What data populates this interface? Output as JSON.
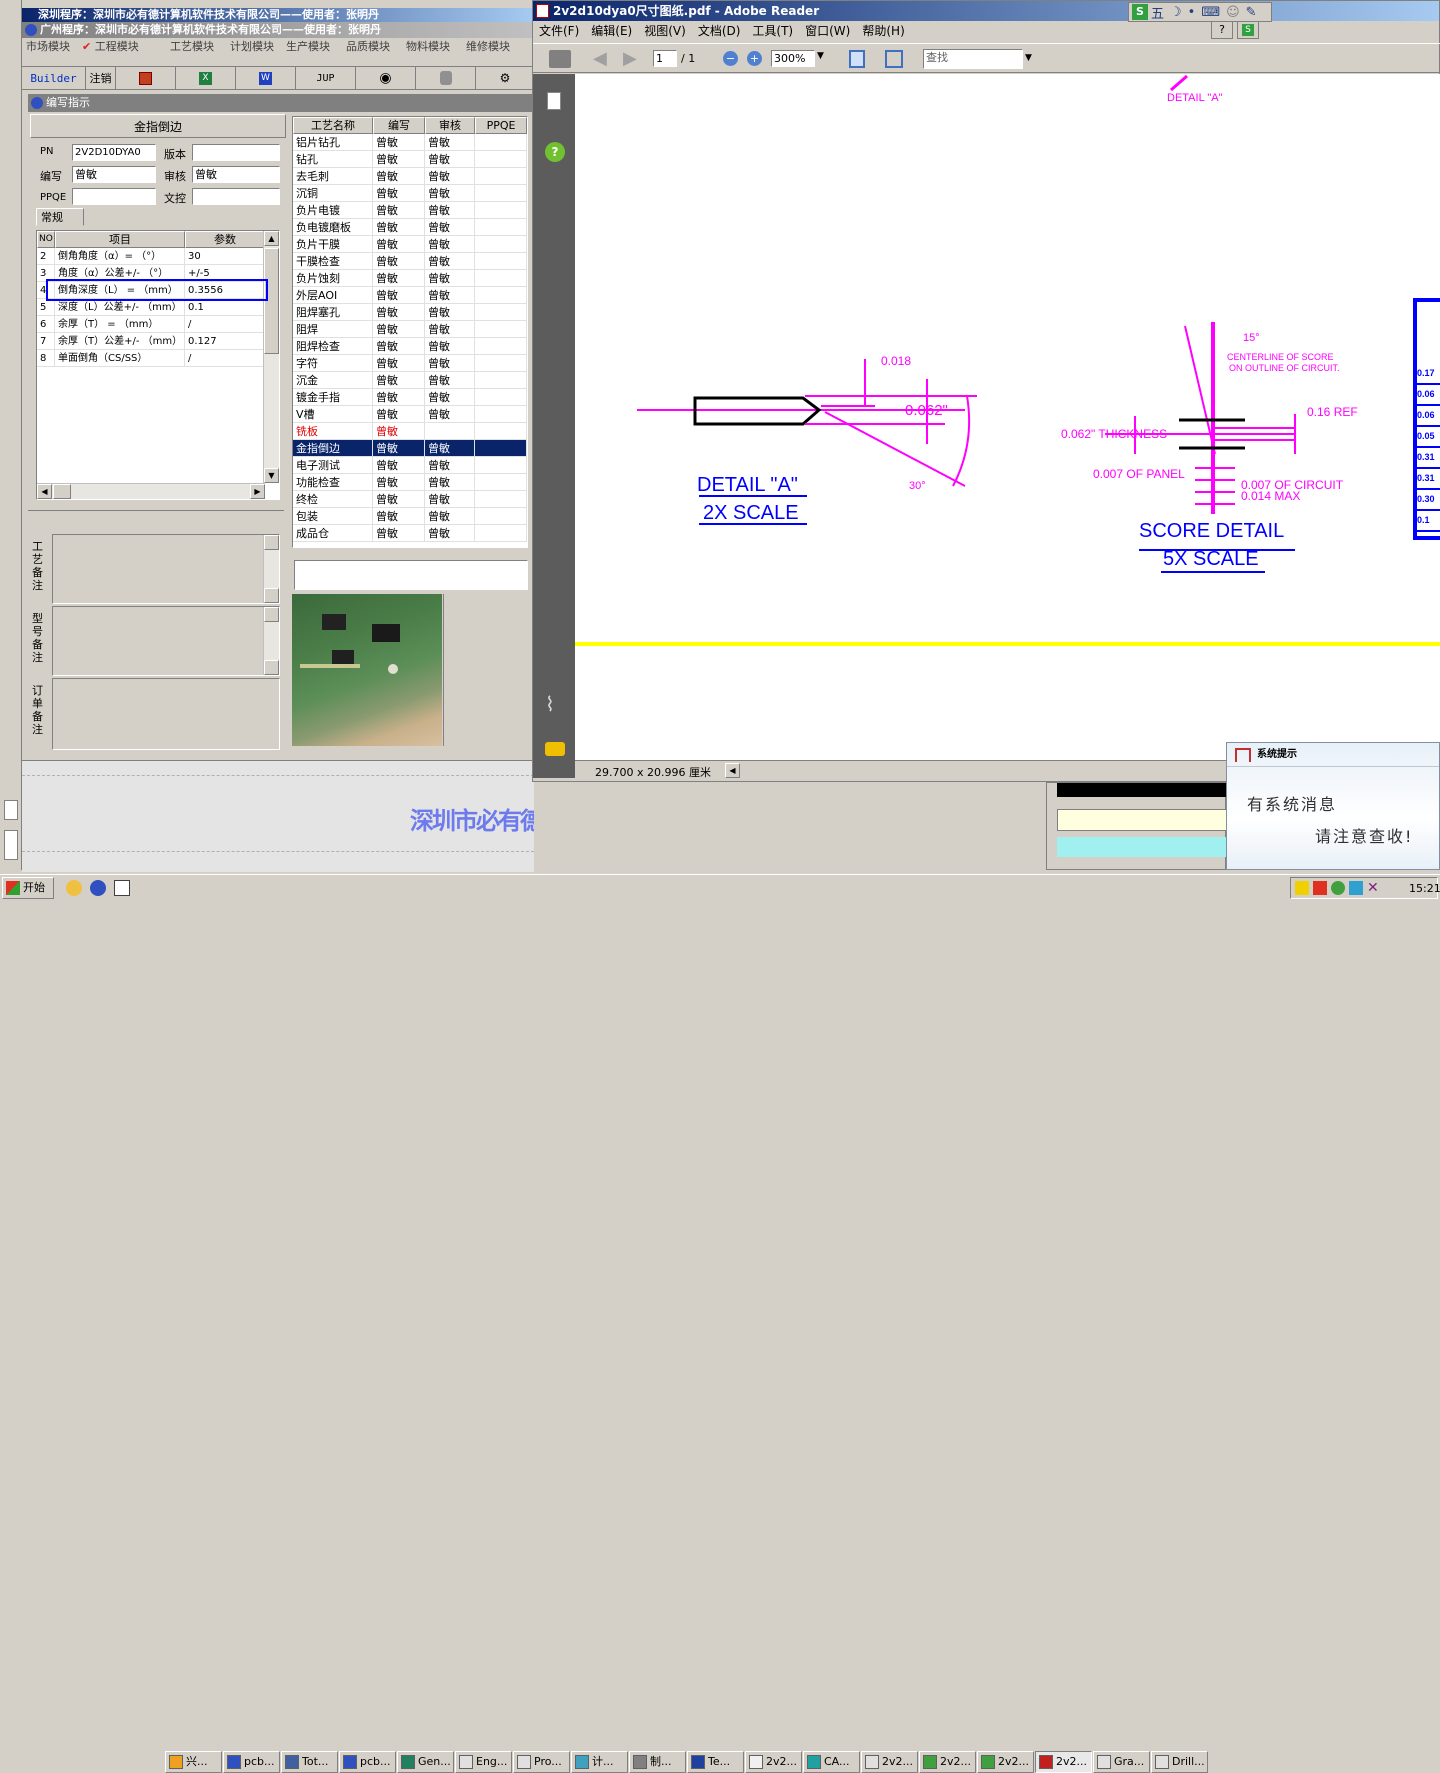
{
  "back_window": {
    "title": "深圳程序：深圳市必有德计算机软件技术有限公司——使用者：张明丹"
  },
  "main_window": {
    "title": "广州程序：深圳市必有德计算机软件技术有限公司——使用者：张明丹",
    "menu": [
      "市场模块",
      "工程模块",
      "工艺模块",
      "计划模块",
      "生产模块",
      "品质模块",
      "物料模块",
      "维修模块"
    ],
    "toolbar": {
      "builder": "Builder",
      "logout": "注销",
      "jup": "JUP"
    },
    "panel_title": "编写指示",
    "form": {
      "heading": "金指倒边",
      "pn_label": "PN",
      "pn_value": "2V2D10DYA0",
      "version_label": "版本",
      "version_value": "",
      "author_label": "编写",
      "author_value": "曾敏",
      "review_label": "审核",
      "review_value": "曾敏",
      "ppqe_label": "PPQE",
      "ppqe_value": "",
      "doc_label": "文控",
      "doc_value": "",
      "tab": "常规"
    },
    "param_table": {
      "headers": [
        "NO",
        "项目",
        "参数"
      ],
      "rows": [
        {
          "no": "2",
          "item": "倒角角度（α）=  （°）",
          "value": "30"
        },
        {
          "no": "3",
          "item": "角度（α）公差+/-  （°）",
          "value": "+/-5"
        },
        {
          "no": "4",
          "item": "倒角深度（L） =  （mm）",
          "value": "0.3556"
        },
        {
          "no": "5",
          "item": "深度（L）公差+/-  （mm）",
          "value": "0.1"
        },
        {
          "no": "6",
          "item": "余厚（T） =  （mm）",
          "value": "/"
        },
        {
          "no": "7",
          "item": "余厚（T）公差+/-  （mm）",
          "value": "0.127"
        },
        {
          "no": "8",
          "item": "单面倒角（CS/SS）",
          "value": "/"
        }
      ]
    },
    "remarks": [
      "工艺备注",
      "型号备注",
      "订单备注"
    ],
    "process_table": {
      "headers": [
        "工艺名称",
        "编写",
        "审核",
        "PPQE"
      ],
      "rows": [
        {
          "name": "铝片钻孔",
          "author": "曾敏",
          "review": "曾敏"
        },
        {
          "name": "钻孔",
          "author": "曾敏",
          "review": "曾敏"
        },
        {
          "name": "去毛刺",
          "author": "曾敏",
          "review": "曾敏"
        },
        {
          "name": "沉铜",
          "author": "曾敏",
          "review": "曾敏"
        },
        {
          "name": "负片电镀",
          "author": "曾敏",
          "review": "曾敏"
        },
        {
          "name": "负电镀磨板",
          "author": "曾敏",
          "review": "曾敏"
        },
        {
          "name": "负片干膜",
          "author": "曾敏",
          "review": "曾敏"
        },
        {
          "name": "干膜检查",
          "author": "曾敏",
          "review": "曾敏"
        },
        {
          "name": "负片蚀刻",
          "author": "曾敏",
          "review": "曾敏"
        },
        {
          "name": "外层AOI",
          "author": "曾敏",
          "review": "曾敏"
        },
        {
          "name": "阻焊塞孔",
          "author": "曾敏",
          "review": "曾敏"
        },
        {
          "name": "阻焊",
          "author": "曾敏",
          "review": "曾敏"
        },
        {
          "name": "阻焊检查",
          "author": "曾敏",
          "review": "曾敏"
        },
        {
          "name": "字符",
          "author": "曾敏",
          "review": "曾敏"
        },
        {
          "name": "沉金",
          "author": "曾敏",
          "review": "曾敏"
        },
        {
          "name": "镀金手指",
          "author": "曾敏",
          "review": "曾敏"
        },
        {
          "name": "V槽",
          "author": "曾敏",
          "review": "曾敏"
        },
        {
          "name": "铣板",
          "author": "曾敏",
          "review": ""
        },
        {
          "name": "金指倒边",
          "author": "曾敏",
          "review": "曾敏"
        },
        {
          "name": "电子测试",
          "author": "曾敏",
          "review": "曾敏"
        },
        {
          "name": "功能检查",
          "author": "曾敏",
          "review": "曾敏"
        },
        {
          "name": "终检",
          "author": "曾敏",
          "review": "曾敏"
        },
        {
          "name": "包装",
          "author": "曾敏",
          "review": "曾敏"
        },
        {
          "name": "成品仓",
          "author": "曾敏",
          "review": "曾敏"
        }
      ]
    },
    "banner": "深圳市必有德计算机软件技术有限公司"
  },
  "reader": {
    "title": "2v2d10dya0尺寸图纸.pdf - Adobe Reader",
    "menu": [
      "文件(F)",
      "编辑(E)",
      "视图(V)",
      "文档(D)",
      "工具(T)",
      "窗口(W)",
      "帮助(H)"
    ],
    "page_current": "1",
    "page_total": "/ 1",
    "zoom": "300%",
    "find_placeholder": "查找",
    "page_size": "29.700 x 20.996 厘米",
    "drawing": {
      "detail_top": "DETAIL \"A\"",
      "dim_018": "0.018",
      "dim_062": "0.062\"",
      "angle_30": "30°",
      "detail_a": "DETAIL \"A\"",
      "scale_2x": "2X SCALE",
      "angle_15": "15°",
      "centerline": "CENTERLINE OF SCORE",
      "outline": "ON OUTLINE OF CIRCUIT.",
      "ref": "0.16  REF",
      "thickness": "0.062\" THICKNESS",
      "panel": "0.007 OF PANEL",
      "circuit": "0.007 OF CIRCUIT",
      "max": "0.014 MAX",
      "score_detail": "SCORE DETAIL",
      "scale_5x": "5X SCALE",
      "right_cells": [
        "0.17",
        "0.06",
        "0.06",
        "0.05",
        "0.31",
        "0.31",
        "0.30",
        "0.1"
      ]
    }
  },
  "ime": {
    "label": "五"
  },
  "notification": {
    "title": "系统提示",
    "line1": "有系统消息",
    "line2": "请注意查收!"
  },
  "taskbar": {
    "start": "开始",
    "tasks": [
      "兴...",
      "pcb...",
      "Tot...",
      "pcb...",
      "Gen...",
      "Eng...",
      "Pro...",
      "计...",
      "制...",
      "Te...",
      "2v2...",
      "CA...",
      "2v2...",
      "2v2...",
      "2v2...",
      "2v2...",
      "Gra...",
      "Drill..."
    ],
    "clock": "15:21"
  },
  "colors": {
    "title_active": "#0a246a",
    "magenta": "#ff00ff",
    "yellow": "#ffff00",
    "selection": "#0a246a",
    "highlight_box": "#0000ff"
  }
}
